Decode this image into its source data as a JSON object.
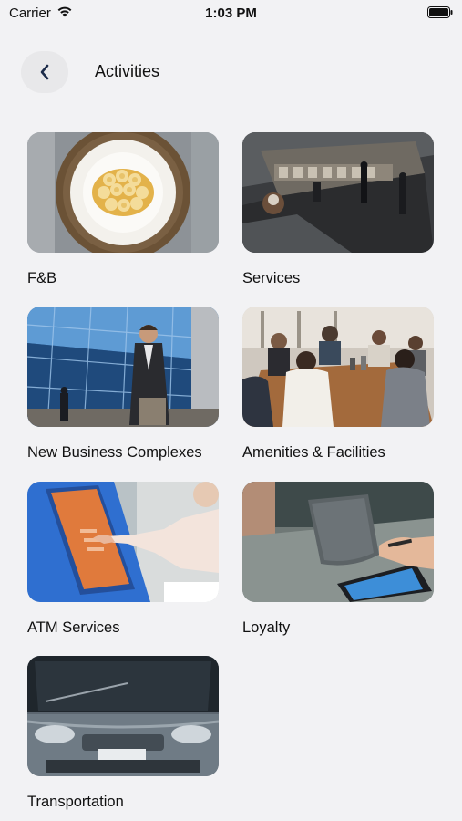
{
  "status": {
    "carrier": "Carrier",
    "time": "1:03 PM"
  },
  "header": {
    "title": "Activities"
  },
  "activities": [
    {
      "label": "F&B",
      "icon": "food-plate-photo"
    },
    {
      "label": "Services",
      "icon": "mall-overview-photo"
    },
    {
      "label": "New Business Complexes",
      "icon": "business-building-photo"
    },
    {
      "label": "Amenities & Facilities",
      "icon": "meeting-table-photo"
    },
    {
      "label": "ATM Services",
      "icon": "atm-kiosk-photo"
    },
    {
      "label": "Loyalty",
      "icon": "payment-terminal-photo"
    },
    {
      "label": "Transportation",
      "icon": "bus-front-photo"
    }
  ],
  "colors": {
    "background": "#f2f2f4",
    "back_button_bg": "#e8e8ea",
    "back_chevron": "#1c2b4a"
  }
}
